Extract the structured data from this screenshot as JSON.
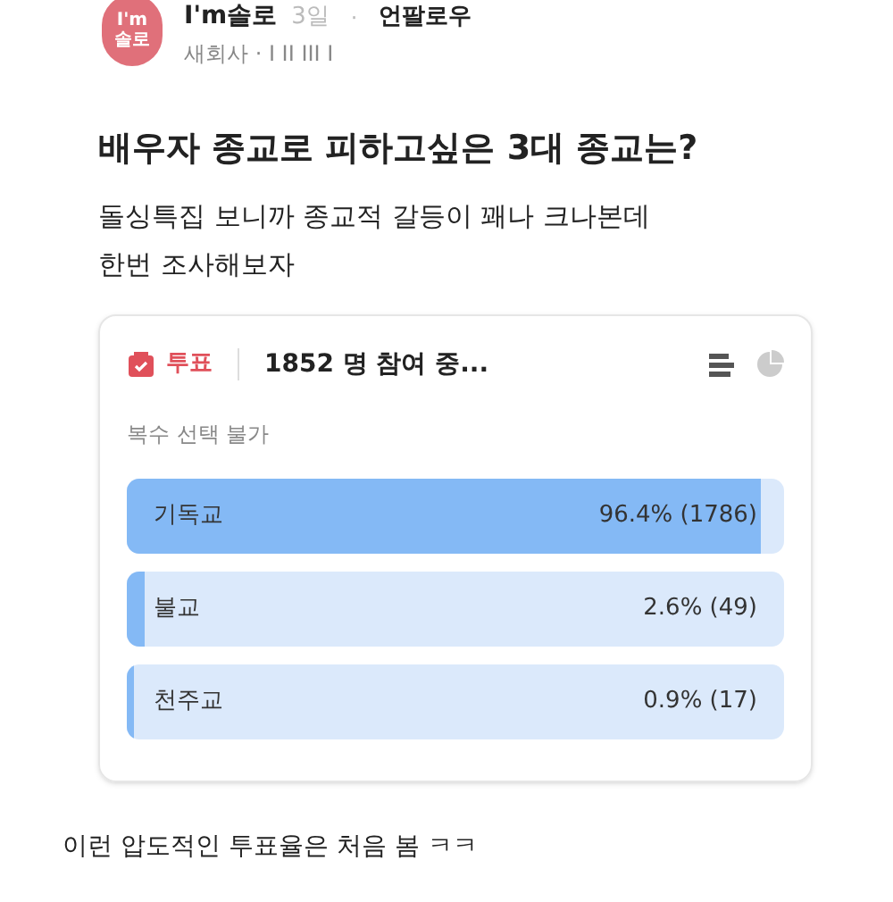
{
  "author": {
    "avatar_text": [
      "I'm",
      "솔로"
    ],
    "name": "I'm솔로",
    "time": "3일",
    "separator": "·",
    "follow": "언팔로우",
    "company": "새회사 · I II III I"
  },
  "post": {
    "title": "배우자 종교로 피하고싶은 3대 종교는?",
    "body": [
      "돌싱특집 보니까 종교적 갈등이 꽤나 크나본데",
      "한번 조사해보자"
    ]
  },
  "poll": {
    "label": "투표",
    "participants": "1852 명 참여 중...",
    "note": "복수 선택 불가",
    "options": [
      {
        "label": "기독교",
        "result": "96.4% (1786)",
        "level": 0.964
      },
      {
        "label": "불교",
        "result": "2.6% (49)",
        "level": 0.026
      },
      {
        "label": "천주교",
        "result": "0.9% (17)",
        "level": 0.009
      }
    ]
  },
  "comment": "이런 압도적인 투표율은 처음 봄 ㅋㅋ"
}
